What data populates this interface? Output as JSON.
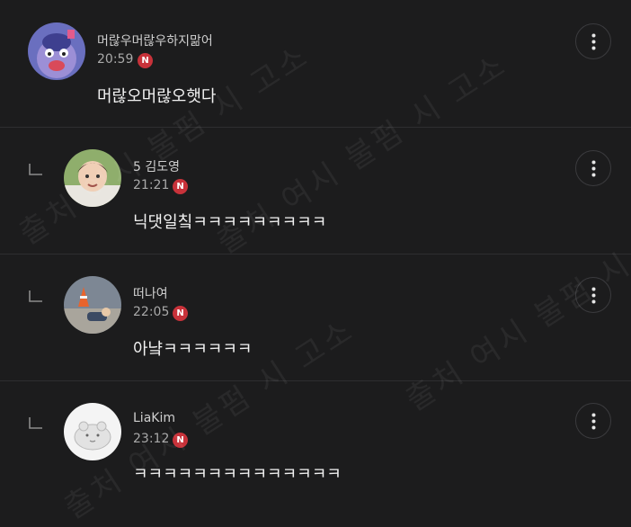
{
  "watermark": {
    "text": "출처 여시 불펌 시 고소"
  },
  "comments": [
    {
      "author": "머랂우머랂우하지맒어",
      "time": "20:59",
      "badge": "N",
      "text": "머랂오머랂오햇다",
      "is_reply": false,
      "menu_icon": "more-vertical-icon"
    },
    {
      "author": "5 김도영",
      "time": "21:21",
      "badge": "N",
      "text": "닉댓일칰ㅋㅋㅋㅋㅋㅋㅋㅋㅋ",
      "is_reply": true,
      "menu_icon": "more-vertical-icon"
    },
    {
      "author": "떠나여",
      "time": "22:05",
      "badge": "N",
      "text": "아냨ㅋㅋㅋㅋㅋㅋ",
      "is_reply": true,
      "menu_icon": "more-vertical-icon"
    },
    {
      "author": "LiaKim",
      "time": "23:12",
      "badge": "N",
      "text": "ㅋㅋㅋㅋㅋㅋㅋㅋㅋㅋㅋㅋㅋㅋ",
      "is_reply": true,
      "menu_icon": "more-vertical-icon"
    }
  ],
  "colors": {
    "background": "#1c1c1d",
    "badge": "#c8323a",
    "divider": "#2e2e30"
  }
}
